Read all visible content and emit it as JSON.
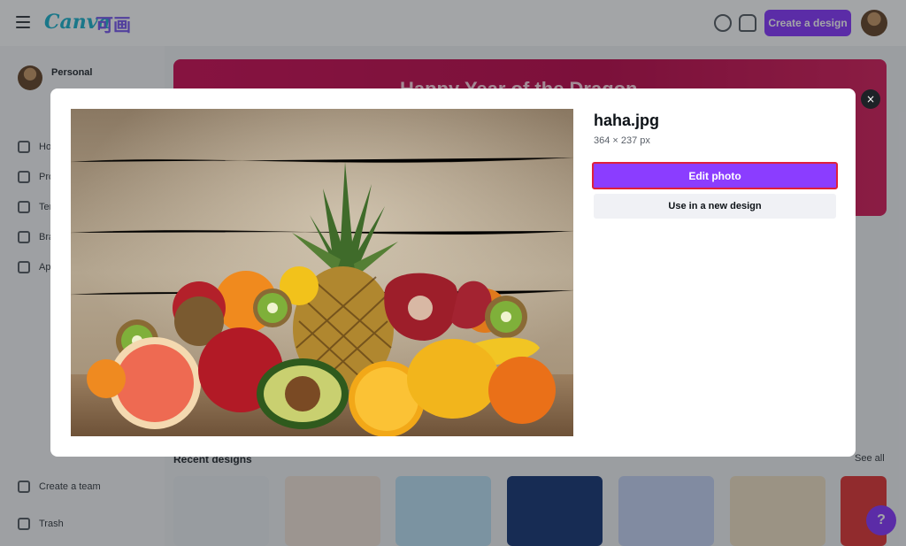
{
  "background": {
    "logo": "Canva",
    "logo_suffix": "可画",
    "create_button": "Create a design",
    "sidebar": {
      "account_name": "Personal",
      "items": [
        "Home",
        "Projects",
        "Templates",
        "Brand",
        "Apps"
      ],
      "bottom_items": [
        "Create a team",
        "Trash"
      ]
    },
    "banner_title": "Happy Year of the Dragon",
    "section_title": "Recent designs",
    "see_all": "See all",
    "fab_label": "?"
  },
  "modal": {
    "file_name": "haha.jpg",
    "dimensions": "364 × 237 px",
    "edit_button": "Edit photo",
    "use_button": "Use in a new design",
    "close_icon": "×",
    "image_subject": "fruit-still-life"
  },
  "colors": {
    "accent": "#8b3dff",
    "highlight_border": "#e0203a",
    "banner": "#d1145a"
  }
}
